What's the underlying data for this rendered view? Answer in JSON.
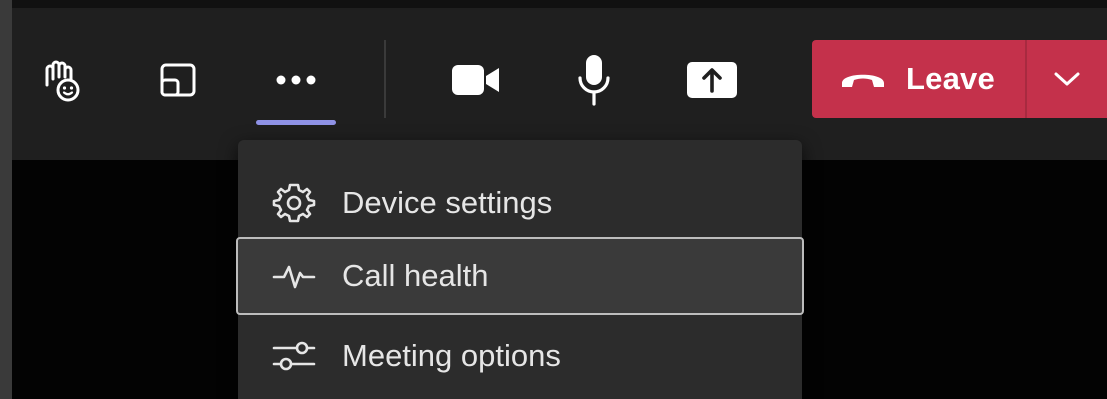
{
  "toolbar": {
    "buttons": [
      {
        "name": "reactions",
        "icon": "raise-hand-reactions-icon"
      },
      {
        "name": "view",
        "icon": "change-view-icon"
      },
      {
        "name": "more-actions",
        "icon": "more-dots-icon",
        "active": true
      },
      {
        "name": "camera",
        "icon": "camera-icon"
      },
      {
        "name": "microphone",
        "icon": "microphone-icon"
      },
      {
        "name": "share",
        "icon": "share-screen-icon"
      }
    ],
    "leave": {
      "label": "Leave",
      "icon": "phone-hangup-icon",
      "color": "#c4314b"
    },
    "active_indicator_color": "#8f92e6"
  },
  "menu": {
    "items": [
      {
        "label": "Device settings",
        "icon": "gear-icon"
      },
      {
        "label": "Call health",
        "icon": "pulse-icon",
        "selected": true
      },
      {
        "label": "Meeting options",
        "icon": "sliders-icon"
      }
    ]
  }
}
